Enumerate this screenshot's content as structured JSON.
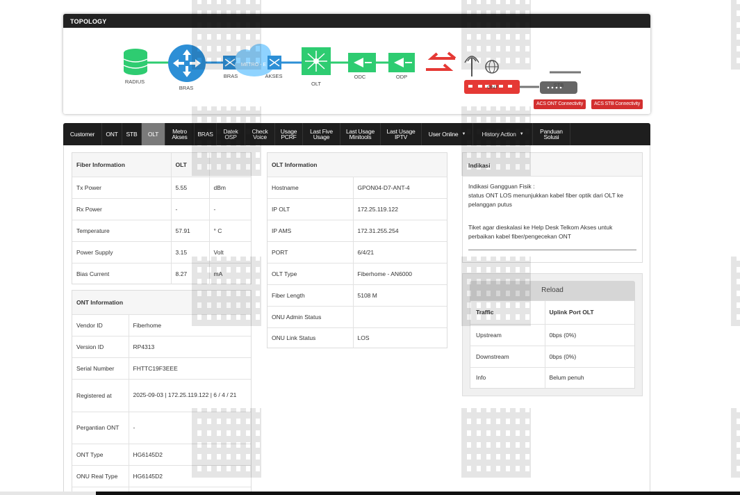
{
  "topology": {
    "title": "TOPOLOGY",
    "nodes": {
      "radius": "RADIUS",
      "bras": "BRAS",
      "bras2": "BRAS",
      "metro": "METRO - E",
      "akses": "AKSES",
      "olt": "OLT",
      "odc": "ODC",
      "odp": "ODP",
      "ont": "ONT",
      "stb": "STB"
    },
    "buttons": {
      "acs_ont": "ACS ONT Connectivity",
      "acs_stb": "ACS STB Connectivity"
    },
    "colors": {
      "green": "#2ecc71",
      "blue": "#2d8fd6",
      "red": "#e53935",
      "gray": "#666666"
    }
  },
  "nav": {
    "items": [
      {
        "l1": "Customer"
      },
      {
        "l1": "ONT"
      },
      {
        "l1": "STB"
      },
      {
        "l1": "OLT"
      },
      {
        "l1": "Metro",
        "l2": "Akses"
      },
      {
        "l1": "BRAS"
      },
      {
        "l1": "Datek",
        "l2": "OSP"
      },
      {
        "l1": "Check",
        "l2": "Voice"
      },
      {
        "l1": "Usage",
        "l2": "PCRF"
      },
      {
        "l1": "Last Five",
        "l2": "Usage"
      },
      {
        "l1": "Last Usage",
        "l2": "Minitools"
      },
      {
        "l1": "Last Usage",
        "l2": "IPTV"
      },
      {
        "l1": "User Online"
      },
      {
        "l1": "History Action"
      },
      {
        "l1": "Panduan",
        "l2": "Solusi"
      }
    ],
    "active": "OLT"
  },
  "fiber": {
    "header": [
      "Fiber Information",
      "OLT",
      ""
    ],
    "rows": [
      [
        "Tx Power",
        "5.55",
        "dBm"
      ],
      [
        "Rx Power",
        "-",
        "-"
      ],
      [
        "Temperature",
        "57.91",
        "° C"
      ],
      [
        "Power Supply",
        "3.15",
        "Volt"
      ],
      [
        "Bias Current",
        "8.27",
        "mA"
      ]
    ]
  },
  "ont_info": {
    "header": "ONT Information",
    "rows": [
      [
        "Vendor ID",
        "Fiberhome"
      ],
      [
        "Version ID",
        "RP4313"
      ],
      [
        "Serial Number",
        "FHTTC19F3EEE"
      ],
      [
        "Registered at",
        "2025-09-03 | 172.25.119.122 | 6 / 4 / 21"
      ],
      [
        "Pergantian ONT",
        "-"
      ],
      [
        "ONT Type",
        "HG6145D2"
      ],
      [
        "ONU Real Type",
        "HG6145D2"
      ]
    ]
  },
  "olt_info": {
    "header": "OLT Information",
    "rows": [
      [
        "Hostname",
        "GPON04-D7-ANT-4"
      ],
      [
        "IP OLT",
        "172.25.119.122"
      ],
      [
        "IP AMS",
        "172.31.255.254"
      ],
      [
        "PORT",
        "6/4/21"
      ],
      [
        "OLT Type",
        "Fiberhome - AN6000"
      ],
      [
        "Fiber Length",
        "5108 M"
      ],
      [
        "ONU Admin Status",
        ""
      ],
      [
        "ONU Link Status",
        "LOS"
      ]
    ]
  },
  "indikasi": {
    "header": "Indikasi",
    "line1": "Indikasi Gangguan Fisik :",
    "line2": "status ONT LOS menunjukkan kabel fiber optik dari OLT ke pelanggan putus",
    "line3": "Tiket agar dieskalasi ke Help Desk Telkom Akses untuk perbaikan kabel fiber/pengecekan ONT"
  },
  "traffic": {
    "reload": "Reload",
    "header": [
      "Traffic",
      "Uplink Port OLT"
    ],
    "rows": [
      [
        "Upstream",
        "0bps (0%)"
      ],
      [
        "Downstream",
        "0bps (0%)"
      ],
      [
        "Info",
        "Belum penuh"
      ]
    ]
  }
}
